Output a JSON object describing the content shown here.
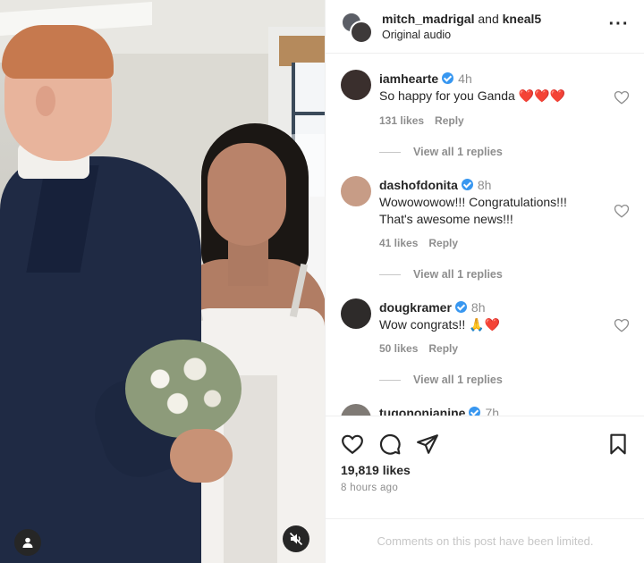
{
  "post": {
    "header": {
      "user_primary": "mitch_madrigal",
      "and_text": "and",
      "user_secondary": "kneal5",
      "audio": "Original audio",
      "more_icon": "more-horizontal-icon"
    },
    "photo": {
      "tag_icon": "user-tag-icon",
      "mute_icon": "muted-speaker-icon"
    },
    "comments": [
      {
        "username": "iamhearte",
        "verified": true,
        "time": "4h",
        "text": "So happy for you Ganda ❤️❤️❤️",
        "likes": "131 likes",
        "reply": "Reply",
        "view_replies": "View all 1 replies"
      },
      {
        "username": "dashofdonita",
        "verified": true,
        "time": "8h",
        "text": "Wowowowow!!! Congratulations!!! That's awesome news!!!",
        "likes": "41 likes",
        "reply": "Reply",
        "view_replies": "View all 1 replies"
      },
      {
        "username": "dougkramer",
        "verified": true,
        "time": "8h",
        "text": "Wow congrats!! 🙏❤️",
        "likes": "50 likes",
        "reply": "Reply",
        "view_replies": "View all 1 replies"
      },
      {
        "username": "tugononianine",
        "verified": true,
        "time": "7h"
      }
    ],
    "actions": {
      "like_icon": "heart-icon",
      "comment_icon": "comment-icon",
      "share_icon": "send-icon",
      "save_icon": "bookmark-icon"
    },
    "likes": "19,819 likes",
    "time_ago": "8 hours ago",
    "limited_notice": "Comments on this post have been limited."
  },
  "colors": {
    "text": "#262626",
    "secondary": "#8e8e8e",
    "verified": "#3897f0",
    "divider": "#efefef"
  }
}
